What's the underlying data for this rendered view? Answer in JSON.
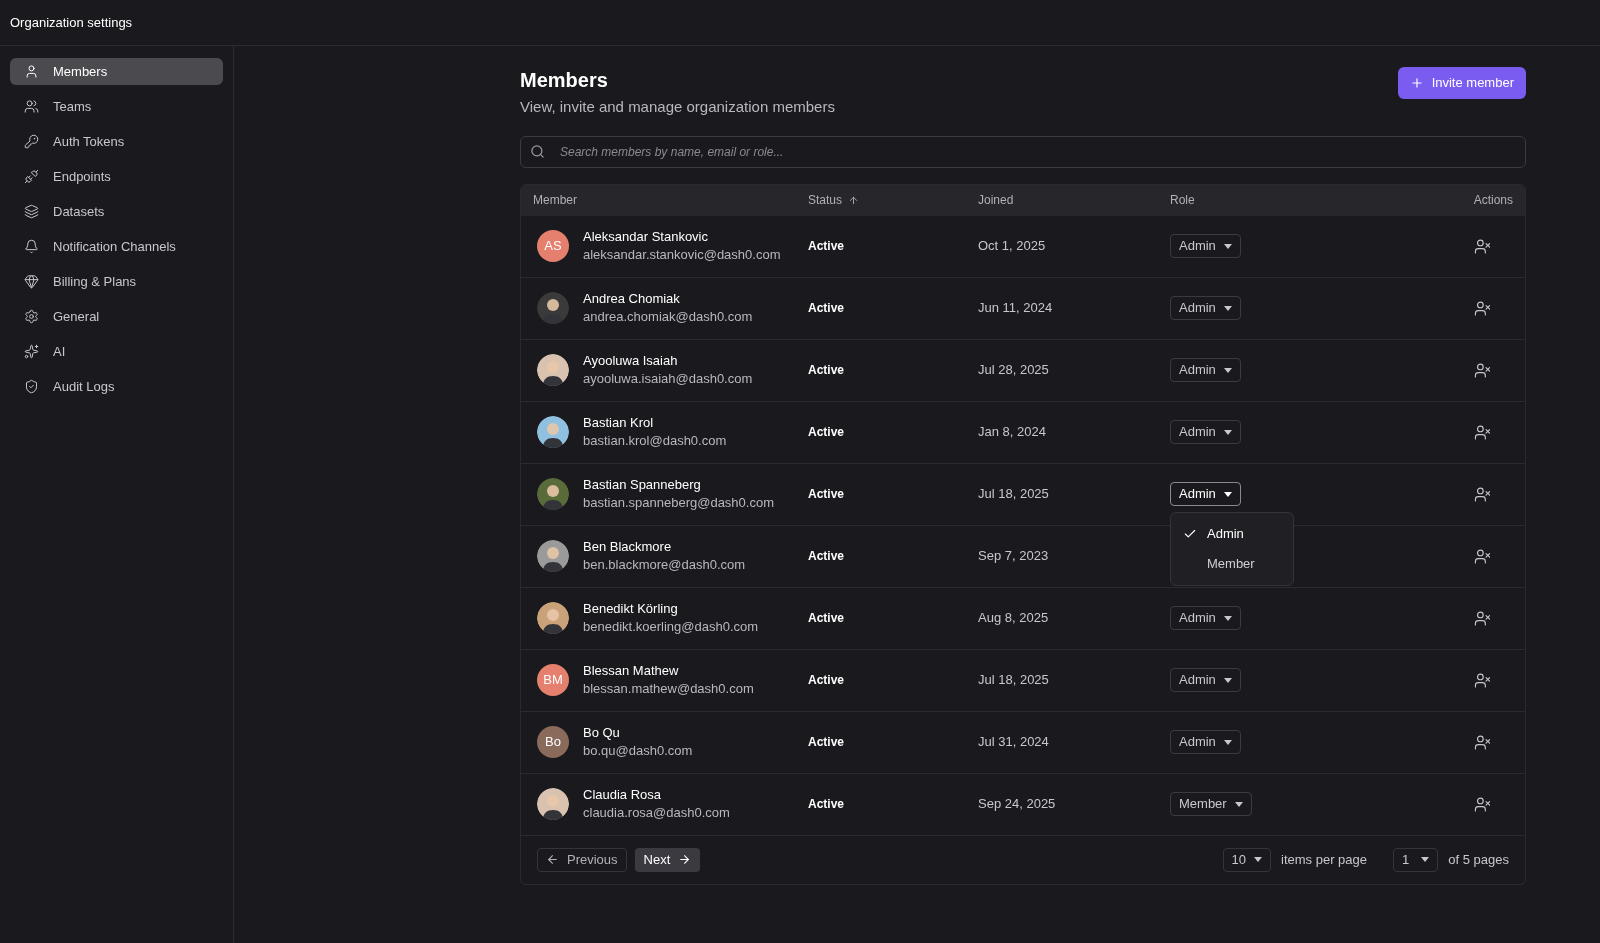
{
  "topbar": {
    "title": "Organization settings"
  },
  "sidebar": {
    "items": [
      {
        "label": "Members",
        "selected": true
      },
      {
        "label": "Teams",
        "selected": false
      },
      {
        "label": "Auth Tokens",
        "selected": false
      },
      {
        "label": "Endpoints",
        "selected": false
      },
      {
        "label": "Datasets",
        "selected": false
      },
      {
        "label": "Notification Channels",
        "selected": false
      },
      {
        "label": "Billing & Plans",
        "selected": false
      },
      {
        "label": "General",
        "selected": false
      },
      {
        "label": "AI",
        "selected": false
      },
      {
        "label": "Audit Logs",
        "selected": false
      }
    ]
  },
  "header": {
    "title": "Members",
    "subtitle": "View, invite and manage organization members",
    "invite_button": "Invite member"
  },
  "search": {
    "placeholder": "Search members by name, email or role..."
  },
  "table": {
    "columns": [
      {
        "label": "Member"
      },
      {
        "label": "Status",
        "sorted_ascending": true
      },
      {
        "label": "Joined"
      },
      {
        "label": "Role"
      },
      {
        "label": "Actions"
      }
    ],
    "rows": [
      {
        "avatar": {
          "kind": "initials",
          "text": "AS",
          "color": "#e57f6e"
        },
        "name": "Aleksandar Stankovic",
        "email": "aleksandar.stankovic@dash0.com",
        "status": "Active",
        "joined": "Oct 1, 2025",
        "role": "Admin",
        "menu_open": false
      },
      {
        "name": "Andrea Chomiak",
        "email": "andrea.chomiak@dash0.com",
        "status": "Active",
        "joined": "Jun 11, 2024",
        "role": "Admin",
        "menu_open": false
      },
      {
        "name": "Ayooluwa Isaiah",
        "email": "ayooluwa.isaiah@dash0.com",
        "status": "Active",
        "joined": "Jul 28, 2025",
        "role": "Admin",
        "menu_open": false
      },
      {
        "name": "Bastian Krol",
        "email": "bastian.krol@dash0.com",
        "status": "Active",
        "joined": "Jan 8, 2024",
        "role": "Admin",
        "menu_open": false
      },
      {
        "name": "Bastian Spanneberg",
        "email": "bastian.spanneberg@dash0.com",
        "status": "Active",
        "joined": "Jul 18, 2025",
        "role": "Admin",
        "menu_open": true,
        "menu": [
          {
            "label": "Admin",
            "selected": true
          },
          {
            "label": "Member",
            "selected": false
          }
        ]
      },
      {
        "name": "Ben Blackmore",
        "email": "ben.blackmore@dash0.com",
        "status": "Active",
        "joined": "Sep 7, 2023",
        "menu_open": false
      },
      {
        "name": "Benedikt Körling",
        "email": "benedikt.koerling@dash0.com",
        "status": "Active",
        "joined": "Aug 8, 2025",
        "role": "Admin",
        "menu_open": false
      },
      {
        "avatar": {
          "kind": "initials",
          "text": "BM",
          "color": "#e57f6e"
        },
        "name": "Blessan Mathew",
        "email": "blessan.mathew@dash0.com",
        "status": "Active",
        "joined": "Jul 18, 2025",
        "role": "Admin",
        "menu_open": false
      },
      {
        "avatar": {
          "kind": "initials",
          "text": "Bo",
          "color": "#8a6a5a"
        },
        "name": "Bo Qu",
        "email": "bo.qu@dash0.com",
        "status": "Active",
        "joined": "Jul 31, 2024",
        "role": "Admin",
        "menu_open": false
      },
      {
        "name": "Claudia Rosa",
        "email": "claudia.rosa@dash0.com",
        "status": "Active",
        "joined": "Sep 24, 2025",
        "role": "Member",
        "menu_open": false
      }
    ]
  },
  "pagination": {
    "previous": {
      "label": "Previous",
      "disabled": true
    },
    "next": {
      "label": "Next",
      "disabled": false
    },
    "page_size": "10",
    "page_size_label": "items per page",
    "page": "1",
    "page_count_label": "of 5 pages"
  }
}
